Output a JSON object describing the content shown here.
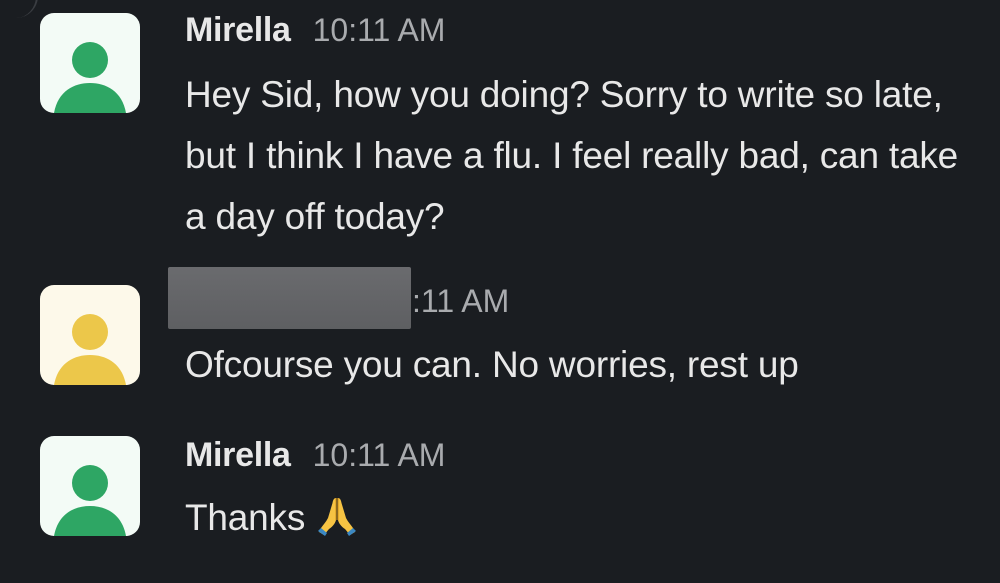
{
  "messages": [
    {
      "author": "Mirella",
      "time": "10:11 AM",
      "text": "Hey Sid, how you doing? Sorry to write so late, but I think I have a flu. I feel really bad, can take a day off today?",
      "avatar_icon": "user-avatar-icon",
      "avatar_color": "#2ea664",
      "avatar_bg": "#f3fbf6"
    },
    {
      "author": "",
      "author_redacted": true,
      "time": ":11 AM",
      "text": "Ofcourse you can. No worries, rest up",
      "avatar_icon": "user-avatar-icon",
      "avatar_color": "#ecc74a",
      "avatar_bg": "#fdf9ea"
    },
    {
      "author": "Mirella",
      "time": "10:11 AM",
      "text": "Thanks",
      "emoji": "folded-hands-icon",
      "avatar_icon": "user-avatar-icon",
      "avatar_color": "#2ea664",
      "avatar_bg": "#f3fbf6"
    }
  ],
  "colors": {
    "background": "#1a1d21",
    "text": "#e8e8e8",
    "timestamp": "#a9abae",
    "redaction": "#636467"
  }
}
